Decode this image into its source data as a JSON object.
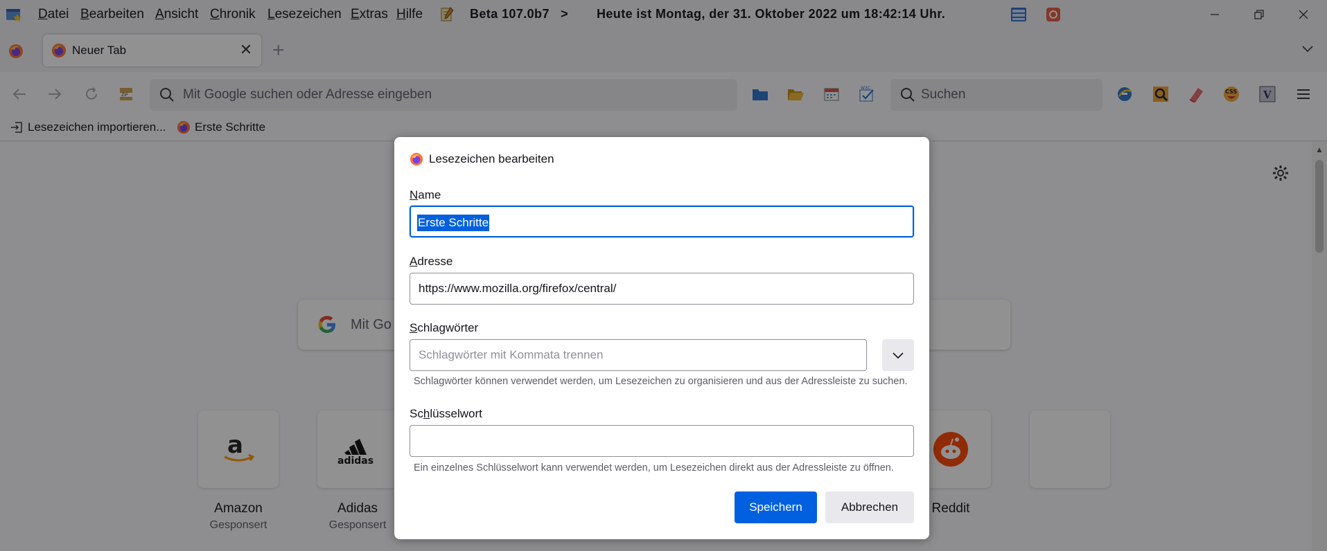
{
  "menubar": {
    "items": [
      {
        "label": "Datei",
        "access": "D",
        "rest": "atei"
      },
      {
        "label": "Bearbeiten",
        "access": "B",
        "rest": "earbeiten"
      },
      {
        "label": "Ansicht",
        "access": "A",
        "rest": "nsicht"
      },
      {
        "label": "Chronik",
        "access": "C",
        "rest": "hronik"
      },
      {
        "label": "Lesezeichen",
        "access": "L",
        "rest": "esezeichen"
      },
      {
        "label": "Extras",
        "access": "E",
        "rest": "xtras"
      },
      {
        "label": "Hilfe",
        "access": "H",
        "rest": "ilfe"
      }
    ],
    "version_text": "Beta 107.0b7   >",
    "datetime_text": "Heute ist Montag, der 31. Oktober 2022 um 18:42:14 Uhr."
  },
  "tabs": {
    "active_title": "Neuer Tab",
    "close_glyph": "✕",
    "new_tab_glyph": "+"
  },
  "navbar": {
    "url_placeholder": "Mit Google suchen oder Adresse eingeben",
    "search_placeholder": "Suchen"
  },
  "bookmarks_bar": {
    "import_label": "Lesezeichen importieren...",
    "first_steps_label": "Erste Schritte"
  },
  "newtab": {
    "search_placeholder": "Mit Go",
    "tiles": [
      {
        "name": "Amazon",
        "sub": "Gesponsert"
      },
      {
        "name": "Adidas",
        "sub": "Gesponsert"
      },
      {
        "name": "Reddit",
        "sub": ""
      }
    ]
  },
  "dialog": {
    "title": "Lesezeichen bearbeiten",
    "name_label": {
      "access": "N",
      "rest": "ame"
    },
    "name_value": "Erste Schritte",
    "address_label": {
      "access": "A",
      "rest": "dresse"
    },
    "address_value": "https://www.mozilla.org/firefox/central/",
    "tags_label": {
      "access": "S",
      "rest": "chlagwörter"
    },
    "tags_placeholder": "Schlagwörter mit Kommata trennen",
    "tags_hint": "Schlagwörter können verwendet werden, um Lesezeichen zu organisieren und aus der Adressleiste zu suchen.",
    "keyword_label": {
      "pre": "Sc",
      "access": "h",
      "rest": "lüsselwort"
    },
    "keyword_value": "",
    "keyword_hint": "Ein einzelnes Schlüsselwort kann verwendet werden, um Lesezeichen direkt aus der Adressleiste zu öffnen.",
    "save_label": "Speichern",
    "cancel_label": "Abbrechen"
  },
  "colors": {
    "accent": "#0060df",
    "chrome_bg": "#f0f0f4",
    "overlay": "rgba(12,12,13,0.45)"
  },
  "icons": {
    "app": "firefox-logo-icon",
    "back": "back-arrow-icon",
    "forward": "forward-arrow-icon",
    "reload": "reload-icon",
    "search": "magnifier-icon",
    "settings": "gear-icon",
    "menu": "hamburger-menu-icon"
  }
}
